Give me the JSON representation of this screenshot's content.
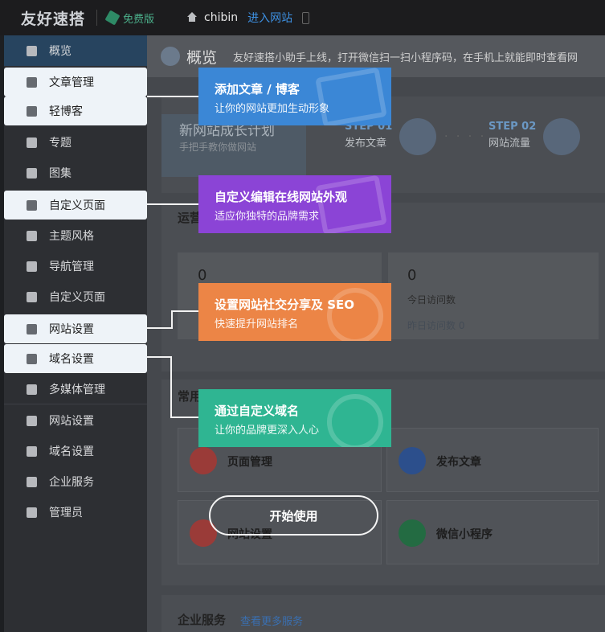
{
  "topbar": {
    "logo": "友好速搭",
    "plan_badge": "免费版",
    "site_name": "chibin",
    "enter_site": "进入网站"
  },
  "sidebar": {
    "items": [
      {
        "label": "概览",
        "icon": "grid-icon"
      },
      {
        "label": "文章管理",
        "icon": "layers-icon"
      },
      {
        "label": "轻博客",
        "icon": "book-icon"
      },
      {
        "label": "专题",
        "icon": "topic-icon"
      },
      {
        "label": "图集",
        "icon": "image-icon"
      },
      {
        "label": "自定义页面",
        "icon": "page-icon"
      },
      {
        "label": "主题风格",
        "icon": "brush-icon"
      },
      {
        "label": "导航管理",
        "icon": "nav-icon"
      },
      {
        "label": "自定义页面",
        "icon": "page-icon"
      },
      {
        "label": "网站设置",
        "icon": "database-icon"
      },
      {
        "label": "域名设置",
        "icon": "globe-icon"
      },
      {
        "label": "多媒体管理",
        "icon": "film-icon"
      },
      {
        "label": "网站设置",
        "icon": "database-icon"
      },
      {
        "label": "域名设置",
        "icon": "globe-icon"
      },
      {
        "label": "企业服务",
        "icon": "cube-icon"
      },
      {
        "label": "管理员",
        "icon": "user-icon"
      }
    ]
  },
  "main": {
    "title": "概览",
    "tip": "友好速搭小助手上线，打开微信扫一扫小程序码，在手机上就能即时查看网",
    "plan": {
      "title": "新网站成长计划",
      "subtitle": "手把手教你做网站",
      "steps": [
        {
          "label": "STEP 01",
          "text": "发布文章"
        },
        {
          "label": "STEP 02",
          "text": "网站流量"
        }
      ]
    },
    "ops_title": "运营",
    "stats": [
      {
        "value": "0",
        "label": "",
        "sub": ""
      },
      {
        "value": "0",
        "label": "今日访问数",
        "sub": "昨日访问数 0"
      }
    ],
    "common_title": "常用",
    "quick": [
      {
        "label": "页面管理",
        "color": "#d9534f"
      },
      {
        "label": "发布文章",
        "color": "#3a6fc9"
      },
      {
        "label": "网站设置",
        "color": "#d9534f"
      },
      {
        "label": "微信小程序",
        "color": "#2f9a5a"
      }
    ],
    "enterprise_title": "企业服务",
    "enterprise_more": "查看更多服务"
  },
  "tour": {
    "callouts": [
      {
        "title": "添加文章 / 博客",
        "sub": "让你的网站更加生动形象",
        "color": "#3b87d6"
      },
      {
        "title": "自定义编辑在线网站外观",
        "sub": "适应你独特的品牌需求",
        "color": "#8b44d6"
      },
      {
        "title": "设置网站社交分享及 SEO",
        "sub": "快速提升网站排名",
        "color": "#ec8546"
      },
      {
        "title": "通过自定义域名",
        "sub": "让你的品牌更深入人心",
        "color": "#2fb592"
      }
    ],
    "start_button": "开始使用"
  }
}
